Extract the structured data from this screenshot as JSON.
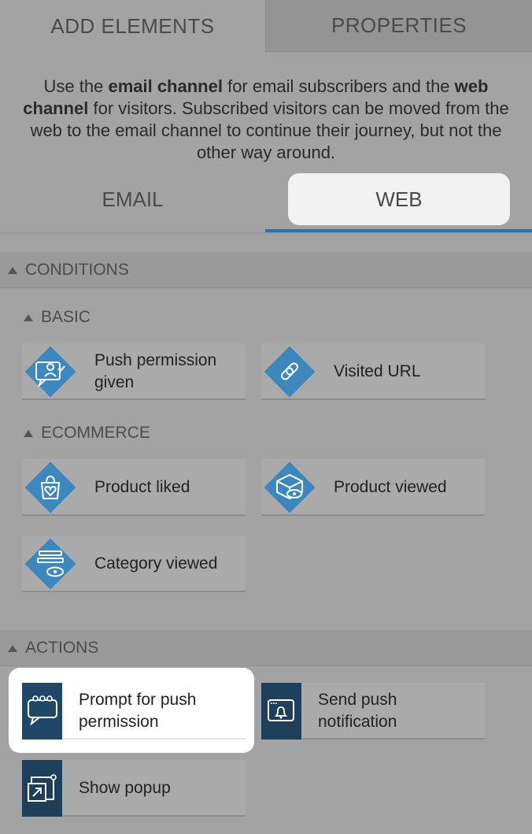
{
  "tabs": {
    "add_elements": "ADD ELEMENTS",
    "properties": "PROPERTIES"
  },
  "info": {
    "p1": "Use the ",
    "b1": "email channel",
    "p2": " for email subscribers and the ",
    "b2": "web channel",
    "p3": " for visitors. Subscribed visitors can be moved from the web to the email channel to continue their journey, but not the other way around."
  },
  "channels": {
    "email": "EMAIL",
    "web": "WEB",
    "active": "WEB"
  },
  "colors": {
    "accent": "#2f72a6",
    "icon_blue": "#3d87bf",
    "action_icon_bg": "#1e3f5a"
  },
  "conditions": {
    "title": "CONDITIONS",
    "basic": {
      "title": "BASIC",
      "items": [
        {
          "label": "Push permission given",
          "icon": "chat-person-check-icon"
        },
        {
          "label": "Visited URL",
          "icon": "link-icon"
        }
      ]
    },
    "ecommerce": {
      "title": "ECOMMERCE",
      "items": [
        {
          "label": "Product liked",
          "icon": "bag-heart-icon"
        },
        {
          "label": "Product viewed",
          "icon": "box-eye-icon"
        },
        {
          "label": "Category viewed",
          "icon": "list-eye-icon"
        }
      ]
    }
  },
  "actions": {
    "title": "ACTIONS",
    "items": [
      {
        "label": "Prompt for push permission",
        "icon": "chat-bubble-icon"
      },
      {
        "label": "Send push notification",
        "icon": "browser-bell-icon"
      },
      {
        "label": "Show popup",
        "icon": "popup-icon"
      }
    ]
  }
}
